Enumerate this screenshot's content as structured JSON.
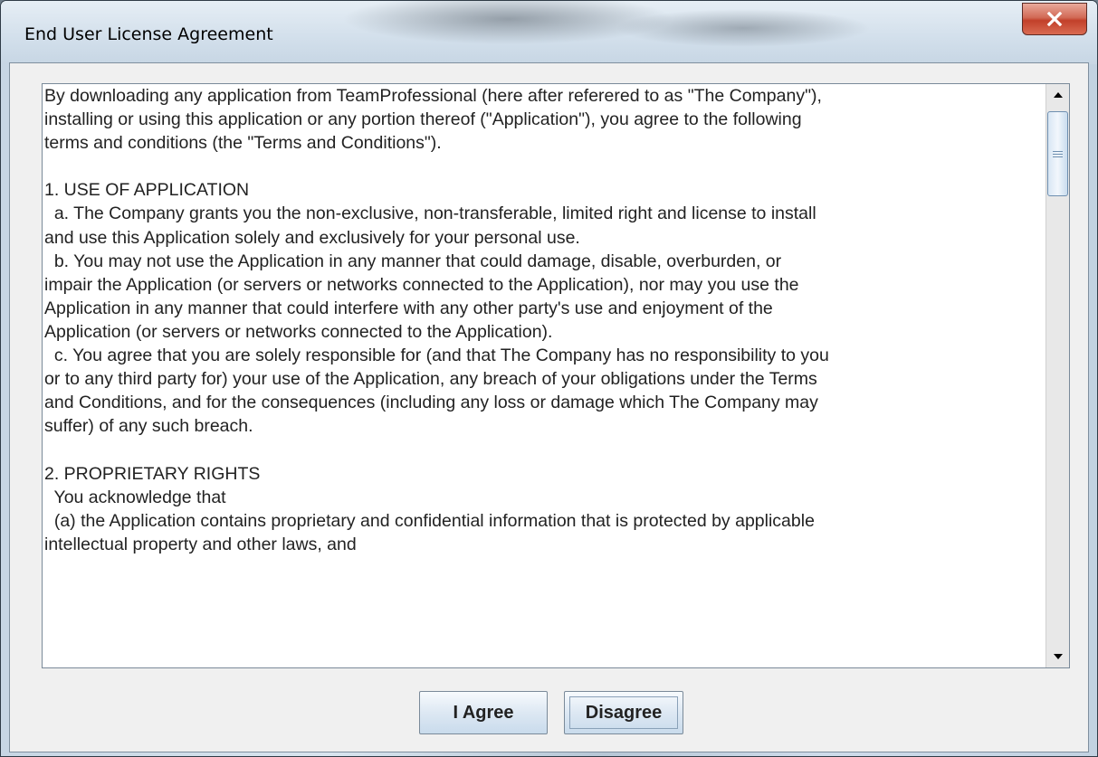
{
  "window": {
    "title": "End User License Agreement",
    "close_icon": "close-x-icon"
  },
  "eula": {
    "lines": [
      "By downloading any application from TeamProfessional (here after referered to as \"The Company\"),",
      "installing or using this application or any portion thereof (\"Application\"), you agree to the following",
      "terms and conditions (the \"Terms and Conditions\").",
      "",
      "1. USE OF APPLICATION",
      "  a. The Company grants you the non-exclusive, non-transferable, limited right and license to install",
      "and use this Application solely and exclusively for your personal use.",
      "  b. You may not use the Application in any manner that could damage, disable, overburden, or",
      "impair the Application (or servers or networks connected to the Application), nor may you use the",
      "Application in any manner that could interfere with any other party's use and enjoyment of the",
      "Application (or servers or networks connected to the Application).",
      "  c. You agree that you are solely responsible for (and that The Company has no responsibility to you",
      "or to any third party for) your use of the Application, any breach of your obligations under the Terms",
      "and Conditions, and for the consequences (including any loss or damage which The Company may",
      "suffer) of any such breach.",
      "",
      "2. PROPRIETARY RIGHTS",
      "  You acknowledge that",
      "  (a) the Application contains proprietary and confidential information that is protected by applicable",
      "intellectual property and other laws, and"
    ]
  },
  "scrollbar": {
    "up_icon": "arrow-up-icon",
    "down_icon": "arrow-down-icon",
    "position": 0.0
  },
  "buttons": {
    "agree_label": "I Agree",
    "disagree_label": "Disagree"
  }
}
